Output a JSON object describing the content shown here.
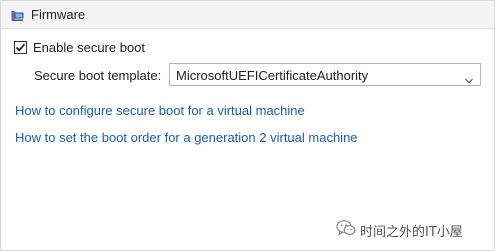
{
  "header": {
    "title": "Firmware",
    "icon": "firmware-chip-icon"
  },
  "secure_boot": {
    "checkbox_label": "Enable secure boot",
    "checked": true,
    "template_label": "Secure boot template:",
    "template_value": "MicrosoftUEFICertificateAuthority"
  },
  "links": {
    "configure": "How to configure secure boot for a virtual machine",
    "boot_order": "How to set the boot order for a generation 2 virtual machine"
  },
  "watermark": {
    "text": "时间之外的IT小屋",
    "icon": "wechat-icon"
  }
}
